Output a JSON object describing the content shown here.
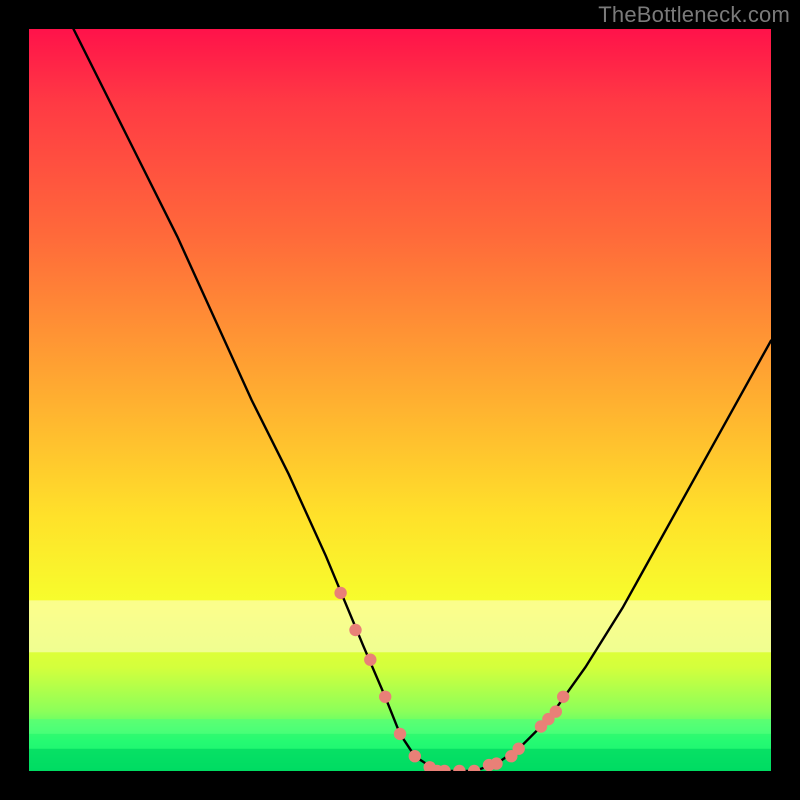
{
  "watermark": "TheBottleneck.com",
  "chart_data": {
    "type": "line",
    "title": "",
    "xlabel": "",
    "ylabel": "",
    "xlim": [
      0,
      100
    ],
    "ylim": [
      0,
      100
    ],
    "series": [
      {
        "name": "bottleneck-curve",
        "x": [
          6,
          10,
          15,
          20,
          25,
          30,
          35,
          40,
          45,
          48,
          50,
          52,
          55,
          58,
          60,
          63,
          66,
          70,
          75,
          80,
          85,
          90,
          95,
          100
        ],
        "y": [
          100,
          92,
          82,
          72,
          61,
          50,
          40,
          29,
          17,
          10,
          5,
          2,
          0,
          0,
          0,
          1,
          3,
          7,
          14,
          22,
          31,
          40,
          49,
          58
        ]
      }
    ],
    "markers": {
      "name": "highlight-dots",
      "color": "#e98077",
      "x": [
        42,
        44,
        46,
        48,
        50,
        52,
        54,
        55,
        56,
        58,
        60,
        62,
        63,
        65,
        66,
        69,
        70,
        71,
        72
      ],
      "y": [
        24,
        19,
        15,
        10,
        5,
        2,
        0.5,
        0,
        0,
        0,
        0,
        0.8,
        1,
        2,
        3,
        6,
        7,
        8,
        10
      ]
    },
    "bands": [
      {
        "name": "pale-yellow",
        "y0": 77,
        "y1": 84,
        "color": "#fffdda",
        "alpha": 0.55
      },
      {
        "name": "green-1",
        "y0": 93,
        "y1": 95,
        "color": "#4bff80",
        "alpha": 0.55
      },
      {
        "name": "green-2",
        "y0": 95,
        "y1": 97,
        "color": "#21f56f",
        "alpha": 0.55
      },
      {
        "name": "green-3",
        "y0": 97,
        "y1": 100,
        "color": "#00d860",
        "alpha": 0.75
      }
    ]
  }
}
